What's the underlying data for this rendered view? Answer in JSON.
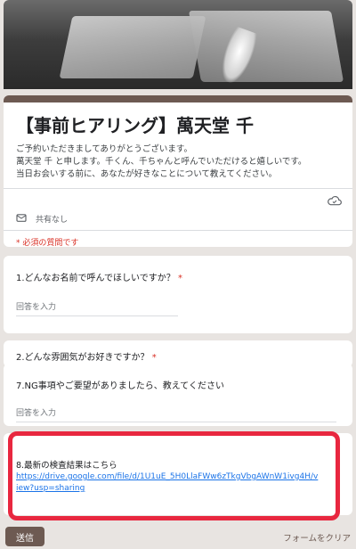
{
  "form": {
    "title": "【事前ヒアリング】萬天堂 千",
    "description": "ご予約いただきましてありがとうございます。\n萬天堂 千 と申します。千くん、千ちゃんと呼んでいただけると嬉しいです。\n当日お会いする前に、あなたが好きなことについて教えてください。",
    "account_text": "共有なし",
    "required_note": "* 必須の質問です"
  },
  "questions": [
    {
      "label": "1.どんなお名前で呼んでほしいですか？",
      "required_mark": "*",
      "placeholder": "回答を入力"
    },
    {
      "label": "2.どんな雰囲気がお好きですか？",
      "required_mark": "*"
    },
    {
      "label": "7.NG事項やご要望がありましたら、教えてください",
      "placeholder": "回答を入力"
    },
    {
      "label": "8.最新の検査結果はこちら",
      "link": "https://drive.google.com/file/d/1U1uE_5H0LlaFWw6zTkgVbgAWnW1ivg4H/view?usp=sharing"
    }
  ],
  "footer": {
    "submit_label": "送信",
    "clear_label": "フォームをクリア"
  },
  "colors": {
    "theme": "#6d5a52",
    "highlight": "#e8273f",
    "required": "#d93025",
    "link": "#1a73e8"
  },
  "icons": [
    "cloud-save-icon",
    "account-icon"
  ]
}
